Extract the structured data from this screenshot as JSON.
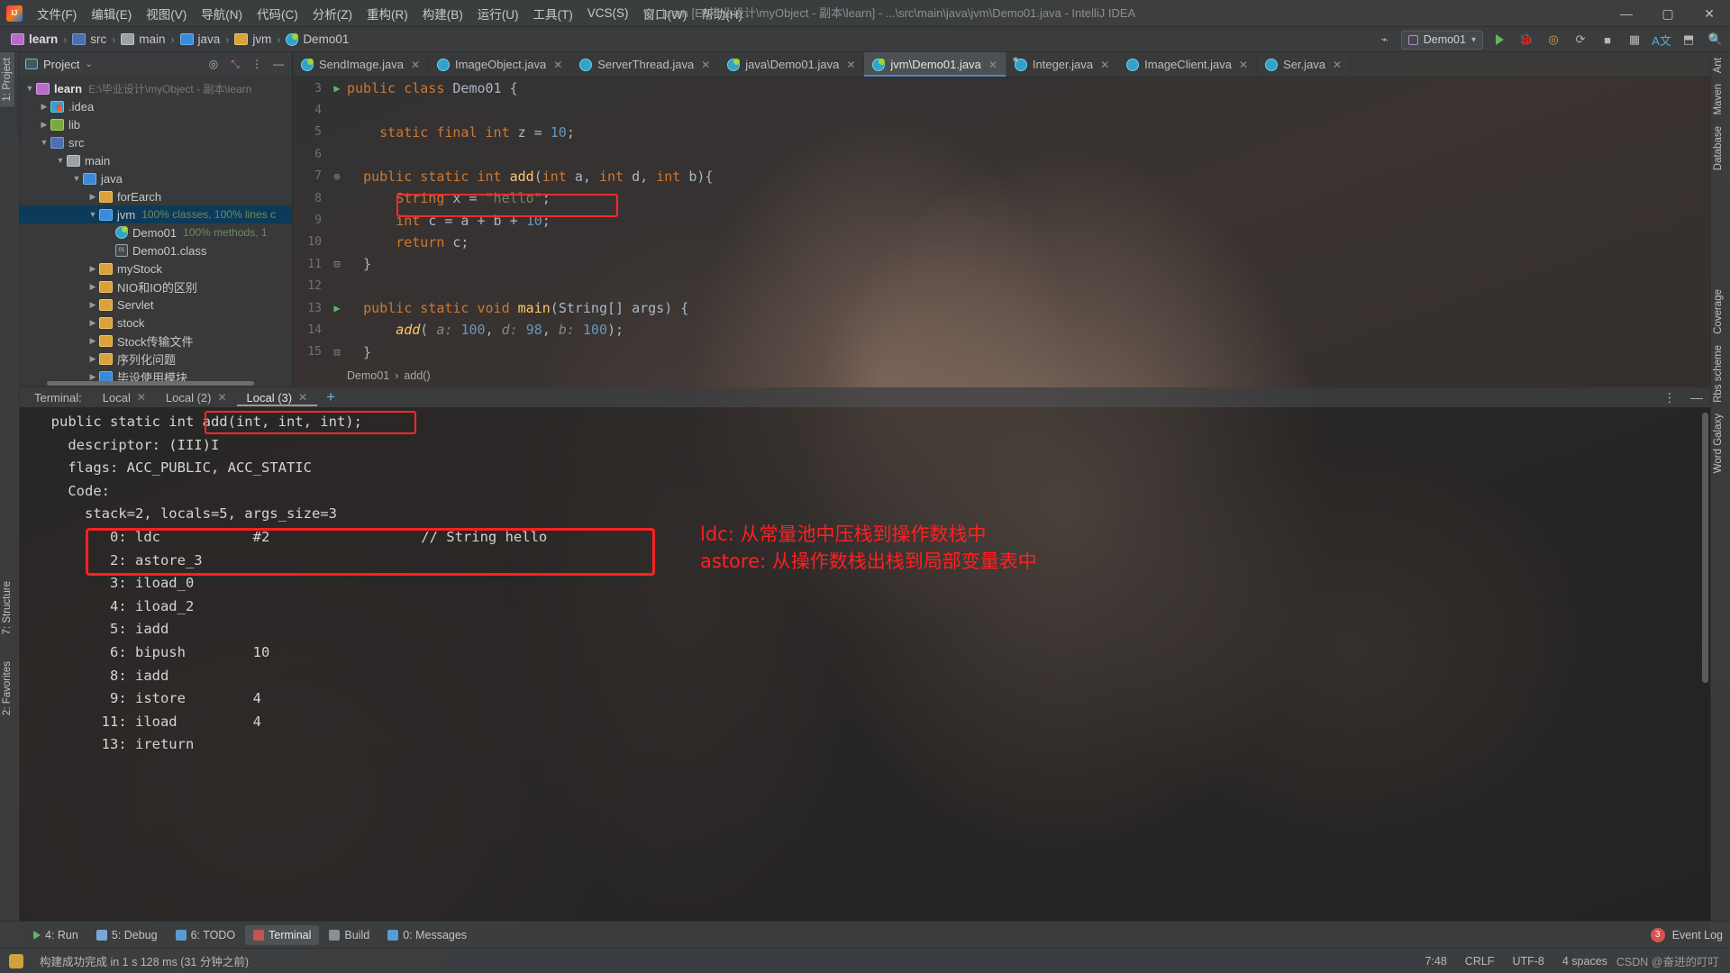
{
  "window": {
    "title": "learn [E:\\毕业设计\\myObject - 副本\\learn] - ...\\src\\main\\java\\jvm\\Demo01.java - IntelliJ IDEA",
    "minimize": "—",
    "maximize": "▢",
    "close": "✕"
  },
  "menubar": {
    "items": [
      {
        "label": "文件(F)"
      },
      {
        "label": "编辑(E)"
      },
      {
        "label": "视图(V)"
      },
      {
        "label": "导航(N)"
      },
      {
        "label": "代码(C)"
      },
      {
        "label": "分析(Z)"
      },
      {
        "label": "重构(R)"
      },
      {
        "label": "构建(B)"
      },
      {
        "label": "运行(U)"
      },
      {
        "label": "工具(T)"
      },
      {
        "label": "VCS(S)"
      },
      {
        "label": "窗口(W)"
      },
      {
        "label": "帮助(H)"
      }
    ]
  },
  "navbar": {
    "crumbs": [
      {
        "label": "learn",
        "icon": "folder-pink-icon"
      },
      {
        "label": "src",
        "icon": "source-root-icon"
      },
      {
        "label": "main",
        "icon": "folder-grey-icon"
      },
      {
        "label": "java",
        "icon": "folder-blue-icon"
      },
      {
        "label": "jvm",
        "icon": "folder-yellow-icon"
      },
      {
        "label": "Demo01",
        "icon": "java-class-icon"
      }
    ],
    "separator": "›",
    "run_config": "Demo01",
    "dropdown_caret": "▾"
  },
  "left_rail": {
    "items": [
      {
        "label": "1: Project",
        "selected": true
      },
      {
        "label": "7: Structure",
        "selected": false
      },
      {
        "label": "2: Favorites",
        "selected": false
      }
    ]
  },
  "right_rail": {
    "items": [
      {
        "label": "Ant"
      },
      {
        "label": "Maven"
      },
      {
        "label": "Database"
      },
      {
        "label": "Coverage"
      },
      {
        "label": "Rbs scheme"
      },
      {
        "label": "Word Galaxy"
      }
    ]
  },
  "project_panel": {
    "title": "Project",
    "tree": [
      {
        "depth": 0,
        "arrow": "▼",
        "label": "learn",
        "bold": true,
        "icon": "folder-pink-icon",
        "dim": "E:\\毕业设计\\myObject - 副本\\learn",
        "selected": false
      },
      {
        "depth": 1,
        "arrow": "▶",
        "label": ".idea",
        "icon": "idea-folder-icon",
        "dim": "",
        "selected": false
      },
      {
        "depth": 1,
        "arrow": "▶",
        "label": "lib",
        "icon": "lib-folder-icon",
        "dim": "",
        "selected": false
      },
      {
        "depth": 1,
        "arrow": "▼",
        "label": "src",
        "icon": "source-root-icon",
        "dim": "",
        "selected": false
      },
      {
        "depth": 2,
        "arrow": "▼",
        "label": "main",
        "icon": "folder-grey-icon",
        "dim": "",
        "selected": false
      },
      {
        "depth": 3,
        "arrow": "▼",
        "label": "java",
        "icon": "folder-blue-icon",
        "dim": "",
        "selected": false
      },
      {
        "depth": 4,
        "arrow": "▶",
        "label": "forEarch",
        "icon": "folder-yellow-icon",
        "dim": "",
        "selected": false
      },
      {
        "depth": 4,
        "arrow": "▼",
        "label": "jvm",
        "icon": "folder-blue-icon",
        "cov": "100% classes, 100% lines c",
        "selected": true
      },
      {
        "depth": 5,
        "arrow": "",
        "label": "Demo01",
        "icon": "java-class-icon",
        "cov": "100% methods, 1",
        "selected": false
      },
      {
        "depth": 5,
        "arrow": "",
        "label": "Demo01.class",
        "icon": "class-file-icon",
        "dim": "",
        "selected": false
      },
      {
        "depth": 4,
        "arrow": "▶",
        "label": "myStock",
        "icon": "folder-yellow-icon",
        "dim": "",
        "selected": false
      },
      {
        "depth": 4,
        "arrow": "▶",
        "label": "NIO和IO的区别",
        "icon": "folder-yellow-icon",
        "dim": "",
        "selected": false
      },
      {
        "depth": 4,
        "arrow": "▶",
        "label": "Servlet",
        "icon": "folder-yellow-icon",
        "dim": "",
        "selected": false
      },
      {
        "depth": 4,
        "arrow": "▶",
        "label": "stock",
        "icon": "folder-yellow-icon",
        "dim": "",
        "selected": false
      },
      {
        "depth": 4,
        "arrow": "▶",
        "label": "Stock传输文件",
        "icon": "folder-yellow-icon",
        "dim": "",
        "selected": false
      },
      {
        "depth": 4,
        "arrow": "▶",
        "label": "序列化问题",
        "icon": "folder-yellow-icon",
        "dim": "",
        "selected": false
      },
      {
        "depth": 4,
        "arrow": "▶",
        "label": "毕设使用模块",
        "icon": "folder-blue-icon",
        "dim": "",
        "selected": false
      }
    ]
  },
  "editor_tabs": [
    {
      "label": "SendImage.java",
      "icon": "java-class-icon",
      "active": false,
      "close": "✕"
    },
    {
      "label": "ImageObject.java",
      "icon": "java-interface-icon",
      "active": false,
      "close": "✕"
    },
    {
      "label": "ServerThread.java",
      "icon": "java-interface-icon",
      "active": false,
      "close": "✕"
    },
    {
      "label": "java\\Demo01.java",
      "icon": "java-class-icon",
      "active": false,
      "close": "✕"
    },
    {
      "label": "jvm\\Demo01.java",
      "icon": "java-class-icon",
      "active": true,
      "close": "✕"
    },
    {
      "label": "Integer.java",
      "icon": "java-library-class-icon",
      "active": false,
      "close": "✕"
    },
    {
      "label": "ImageClient.java",
      "icon": "java-interface-icon",
      "active": false,
      "close": "✕"
    },
    {
      "label": "Ser.java",
      "icon": "java-interface-icon",
      "active": false,
      "close": "✕"
    }
  ],
  "editor": {
    "lines": [
      {
        "num": "3",
        "gutter_mark": "▶",
        "fold": "",
        "text": "public class Demo01 {"
      },
      {
        "num": "4",
        "gutter_mark": "",
        "fold": "",
        "text": ""
      },
      {
        "num": "5",
        "gutter_mark": "",
        "fold": "",
        "text": "    static final int z = 10;"
      },
      {
        "num": "6",
        "gutter_mark": "",
        "fold": "",
        "text": ""
      },
      {
        "num": "7",
        "gutter_mark": "",
        "fold": "⊕",
        "text": "    public static int add(int a, int d, int b){"
      },
      {
        "num": "8",
        "gutter_mark": "",
        "fold": "",
        "text": "        String x = \"hello\";"
      },
      {
        "num": "9",
        "gutter_mark": "",
        "fold": "",
        "text": "        int c = a + b + 10;"
      },
      {
        "num": "10",
        "gutter_mark": "",
        "fold": "",
        "text": "        return c;"
      },
      {
        "num": "11",
        "gutter_mark": "",
        "fold": "⊟",
        "text": "    }"
      },
      {
        "num": "12",
        "gutter_mark": "",
        "fold": "",
        "text": ""
      },
      {
        "num": "13",
        "gutter_mark": "▶",
        "fold": "",
        "text": "    public static void main(String[] args) {"
      },
      {
        "num": "14",
        "gutter_mark": "",
        "fold": "",
        "text": "        add( a: 100, d: 98, b: 100);"
      },
      {
        "num": "15",
        "gutter_mark": "",
        "fold": "⊟",
        "text": "    }"
      }
    ],
    "highlight_text": "String x = \"hello\";",
    "breadcrumb": [
      "Demo01",
      "add()"
    ],
    "breadcrumb_sep": "›"
  },
  "terminal": {
    "label": "Terminal:",
    "tabs": [
      {
        "label": "Local",
        "close": "✕",
        "active": false
      },
      {
        "label": "Local (2)",
        "close": "✕",
        "active": false
      },
      {
        "label": "Local (3)",
        "close": "✕",
        "active": true
      }
    ],
    "new_tab": "+",
    "settings_icon": "⋮",
    "hide_icon": "—",
    "lines": [
      "  public static int add(int, int, int);",
      "    descriptor: (III)I",
      "    flags: ACC_PUBLIC, ACC_STATIC",
      "    Code:",
      "      stack=2, locals=5, args_size=3",
      "         0: ldc           #2                  // String hello",
      "         2: astore_3",
      "         3: iload_0",
      "         4: iload_2",
      "         5: iadd",
      "         6: bipush        10",
      "         8: iadd",
      "         9: istore        4",
      "        11: iload         4",
      "        13: ireturn"
    ]
  },
  "annotations": {
    "line1": "ldc: 从常量池中压栈到操作数栈中",
    "line2": "astore: 从操作数栈出栈到局部变量表中",
    "color": "#ff2020"
  },
  "bottombar": {
    "items": [
      {
        "label": "4: Run",
        "icon": "run-icon",
        "active": false
      },
      {
        "label": "5: Debug",
        "icon": "debug-icon",
        "active": false
      },
      {
        "label": "6: TODO",
        "icon": "todo-icon",
        "active": false
      },
      {
        "label": "Terminal",
        "icon": "terminal-icon",
        "active": true
      },
      {
        "label": "Build",
        "icon": "build-icon",
        "active": false
      },
      {
        "label": "0: Messages",
        "icon": "messages-icon",
        "active": false
      }
    ],
    "event_log": "Event Log",
    "event_count": "3"
  },
  "statusbar": {
    "message": "构建成功完成 in 1 s 128 ms (31 分钟之前)",
    "caret": "7:48",
    "line_sep": "CRLF",
    "encoding": "UTF-8",
    "indent": "4 spaces",
    "watermark": "CSDN @奋进的叮叮"
  }
}
